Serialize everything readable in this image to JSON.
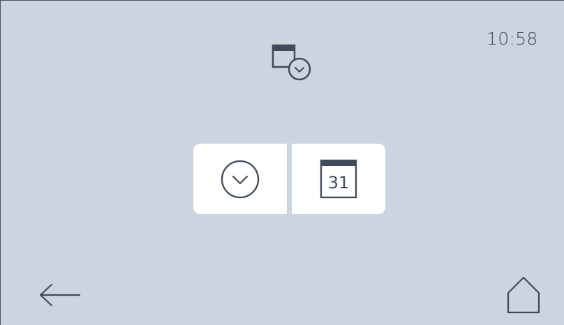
{
  "status": {
    "time": "10:58"
  },
  "header": {
    "icon": "calendar-clock-icon"
  },
  "options": [
    {
      "icon": "clock-icon"
    },
    {
      "icon": "calendar-icon",
      "day_number": "31"
    }
  ],
  "navigation": {
    "back_icon": "back-arrow-icon",
    "home_icon": "home-icon"
  },
  "colors": {
    "background": "#cbd4df",
    "icon": "#3f4b5b",
    "tile": "#ffffff"
  }
}
